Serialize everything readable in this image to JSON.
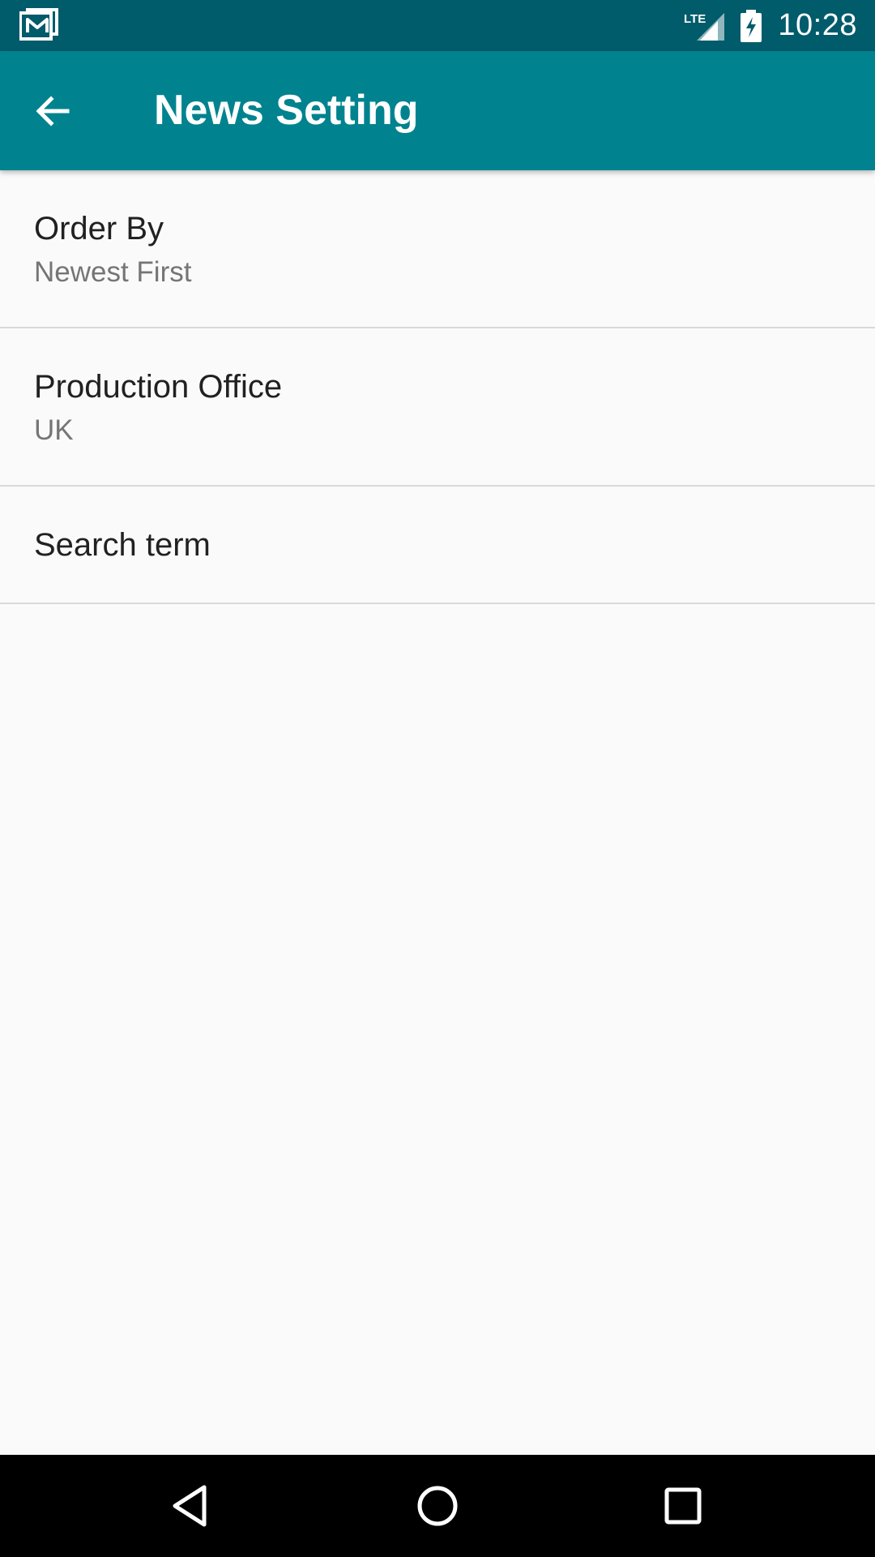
{
  "status_bar": {
    "notification_icon": "gmail-icon",
    "network_label": "LTE",
    "time": "10:28"
  },
  "app_bar": {
    "back_icon": "arrow-back-icon",
    "title": "News Setting"
  },
  "preferences": [
    {
      "title": "Order By",
      "summary": "Newest First"
    },
    {
      "title": "Production Office",
      "summary": "UK"
    },
    {
      "title": "Search term"
    }
  ],
  "nav_bar": {
    "back_icon": "triangle-back-icon",
    "home_icon": "circle-home-icon",
    "recents_icon": "square-recents-icon"
  },
  "colors": {
    "status_bar": "#005b6b",
    "app_bar": "#00838f",
    "background": "#fafafa",
    "nav_bar": "#000000"
  }
}
